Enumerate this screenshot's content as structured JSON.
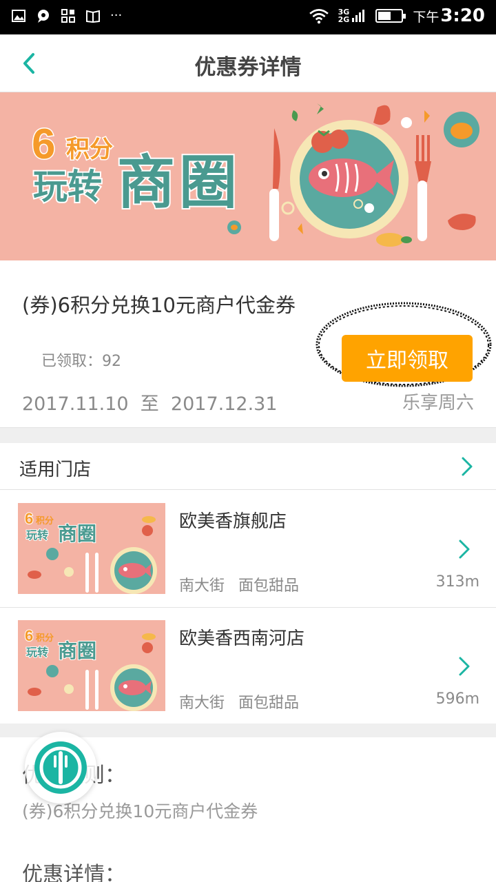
{
  "status_bar": {
    "network": "3G\n2G",
    "network_top": "3G",
    "network_bottom": "2G",
    "time_prefix": "下午",
    "time": "3:20",
    "battery_level": 0.55
  },
  "header": {
    "title": "优惠券详情"
  },
  "banner": {
    "points_number": "6",
    "points_text": "积分",
    "line2_small": "玩转",
    "line2_big": "商圈"
  },
  "coupon": {
    "title": "(券)6积分兑换10元商户代金券",
    "claimed": "已领取：92",
    "claim_button": "立即领取",
    "date_range": "2017.11.10  至  2017.12.31",
    "tag": "乐享周六"
  },
  "stores": {
    "header_label": "适用门店",
    "items": [
      {
        "name": "欧美香旗舰店",
        "street": "南大街",
        "category": "面包甜品",
        "distance": "313m"
      },
      {
        "name": "欧美香西南河店",
        "street": "南大街",
        "category": "面包甜品",
        "distance": "596m"
      }
    ]
  },
  "rules": {
    "heading": "优惠细则：",
    "text": "(券)6积分兑换10元商户代金券",
    "details_heading": "优惠详情："
  },
  "colors": {
    "accent": "#1bb5a3",
    "claim_button": "#ffa300",
    "banner_bg": "#f4b3a4",
    "plate": "#5aa9a0"
  },
  "icons": {
    "back": "chevron-left-icon",
    "row_arrow": "chevron-right-icon",
    "float": "fork-knife-icon"
  }
}
